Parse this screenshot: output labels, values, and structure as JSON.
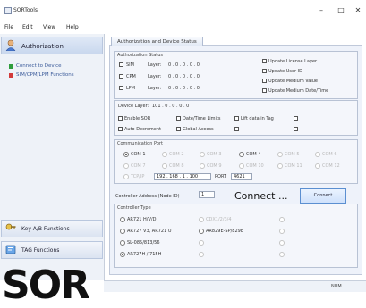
{
  "window": {
    "title": "SORTools",
    "minimize": "–",
    "maximize": "□",
    "close": "✕"
  },
  "menu": [
    "File",
    "Edit",
    "View",
    "Help"
  ],
  "sidebar": {
    "header": "Authorization",
    "items": [
      {
        "label": "Connect to Device",
        "icon_color": "#2e9d3c"
      },
      {
        "label": "SIM/CPM/LPM Functions",
        "icon_color": "#d23a3a"
      }
    ],
    "groups": [
      "Key A/B Functions",
      "TAG Functions"
    ]
  },
  "logo": "SOR",
  "tab": "Authorization and Device Status",
  "auth_status": {
    "title": "Authorization Status",
    "layers": [
      {
        "name": "SIM",
        "label": "Layer:",
        "value": "0 . 0 . 0 . 0 . 0"
      },
      {
        "name": "CPM",
        "label": "Layer:",
        "value": "0 . 0 . 0 . 0 . 0"
      },
      {
        "name": "LPM",
        "label": "Layer:",
        "value": "0 . 0 . 0 . 0 . 0"
      }
    ],
    "updates": [
      "Update License Layer",
      "Update User ID",
      "Update Medium Value",
      "Update Medium Date/Time"
    ]
  },
  "device_layer": {
    "label": "Device Layer:",
    "value": "101 . 0 . 0 . 0 . 0",
    "options": [
      "Enable SOR",
      "Date/Time Limits",
      "Lift data in Tag",
      "Auto Decrement",
      "Global Access"
    ]
  },
  "comm_port": {
    "title": "Communication Port",
    "ports": [
      "COM 1",
      "COM 2",
      "COM 3",
      "COM 4",
      "COM 5",
      "COM 6",
      "COM 7",
      "COM 8",
      "COM 9",
      "COM 10",
      "COM 11",
      "COM 12"
    ],
    "tcpip_label": "TCP/IP",
    "ip": "192 . 168 . 1 . 100",
    "port_label": "PORT",
    "port": "4621"
  },
  "controller": {
    "address_label": "Controller Address (Node ID)",
    "address": "1",
    "connect_text": "Connect ...",
    "connect_button": "Connect",
    "type_title": "Controller Type",
    "types": [
      "AR721 H/V/D",
      "CDX1/2/3/4",
      "AR727 V3, AR721 U",
      "AR829E-SP/829E",
      "SL-085/813/56",
      "AR727H / 715H"
    ]
  },
  "status": {
    "num": "NUM"
  }
}
